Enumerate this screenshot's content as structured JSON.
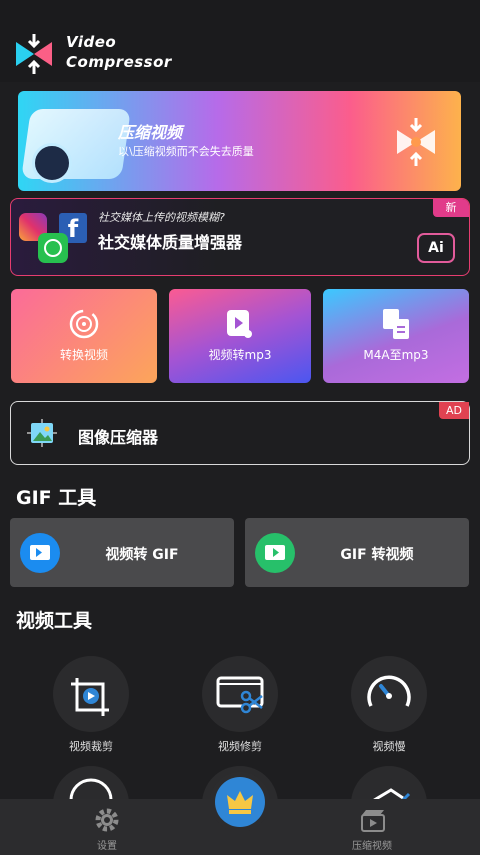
{
  "app": {
    "brand_line1": "Video",
    "brand_line2": "Compressor"
  },
  "banner": {
    "title": "压缩视频",
    "subtitle": "以\\压缩视频而不会失去质量"
  },
  "social_enhancer": {
    "question": "社交媒体上传的视频模糊?",
    "title": "社交媒体质量增强器",
    "badge": "新",
    "ai_label": "Ai"
  },
  "feature_cards": [
    {
      "label": "转换视频"
    },
    {
      "label": "视频转mp3"
    },
    {
      "label": "M4A至mp3"
    }
  ],
  "image_compressor": {
    "title": "图像压缩器",
    "badge": "AD"
  },
  "gif_section": {
    "title": "GIF 工具",
    "buttons": [
      {
        "label": "视频转 GIF",
        "icon": "video-to-gif-icon",
        "color": "#1b8cf0"
      },
      {
        "label": "GIF 转视频",
        "icon": "gif-to-video-icon",
        "color": "#27c06a"
      }
    ]
  },
  "video_tools": {
    "title": "视频工具",
    "items": [
      {
        "label": "视频裁剪",
        "icon": "crop-icon"
      },
      {
        "label": "视频修剪",
        "icon": "scissors-icon"
      },
      {
        "label": "视频慢",
        "icon": "speedometer-icon"
      }
    ]
  },
  "bottom_nav": {
    "settings": "设置",
    "compress": "压缩视频"
  },
  "colors": {
    "background": "#1e1e20",
    "accent_pink": "#e63d70",
    "fab": "#2f86d6"
  }
}
